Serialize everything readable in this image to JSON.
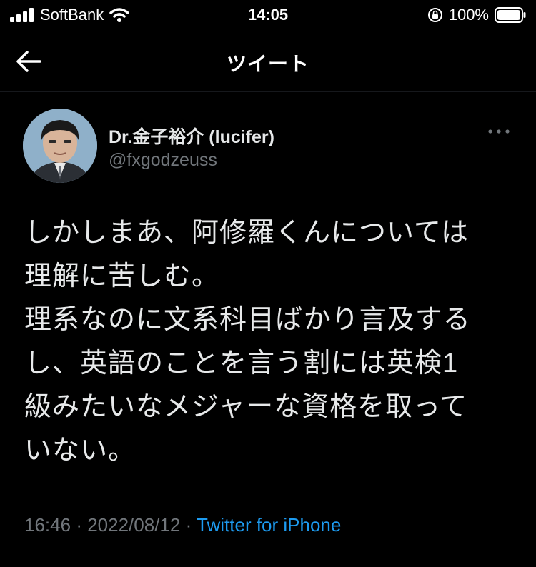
{
  "status_bar": {
    "carrier": "SoftBank",
    "time": "14:05",
    "battery": "100%",
    "icons": [
      "signal-icon",
      "wifi-icon",
      "orientation-lock-icon",
      "battery-icon"
    ]
  },
  "nav": {
    "title": "ツイート",
    "back_icon": "back-arrow-icon"
  },
  "tweet": {
    "display_name": "Dr.金子裕介 (lucifer)",
    "handle": "@fxgodzeuss",
    "text": "しかしまあ、阿修羅くんについては\n理解に苦しむ。\n理系なのに文系科目ばかり言及する\nし、英語のことを言う割には英検1\n級みたいなメジャーな資格を取って\nいない。",
    "time": "16:46",
    "separator": "·",
    "date": "2022/08/12",
    "app": "Twitter for iPhone"
  },
  "colors": {
    "background": "#000000",
    "text": "#e7e9ea",
    "secondary": "#71767b",
    "link": "#1d9bf0"
  }
}
